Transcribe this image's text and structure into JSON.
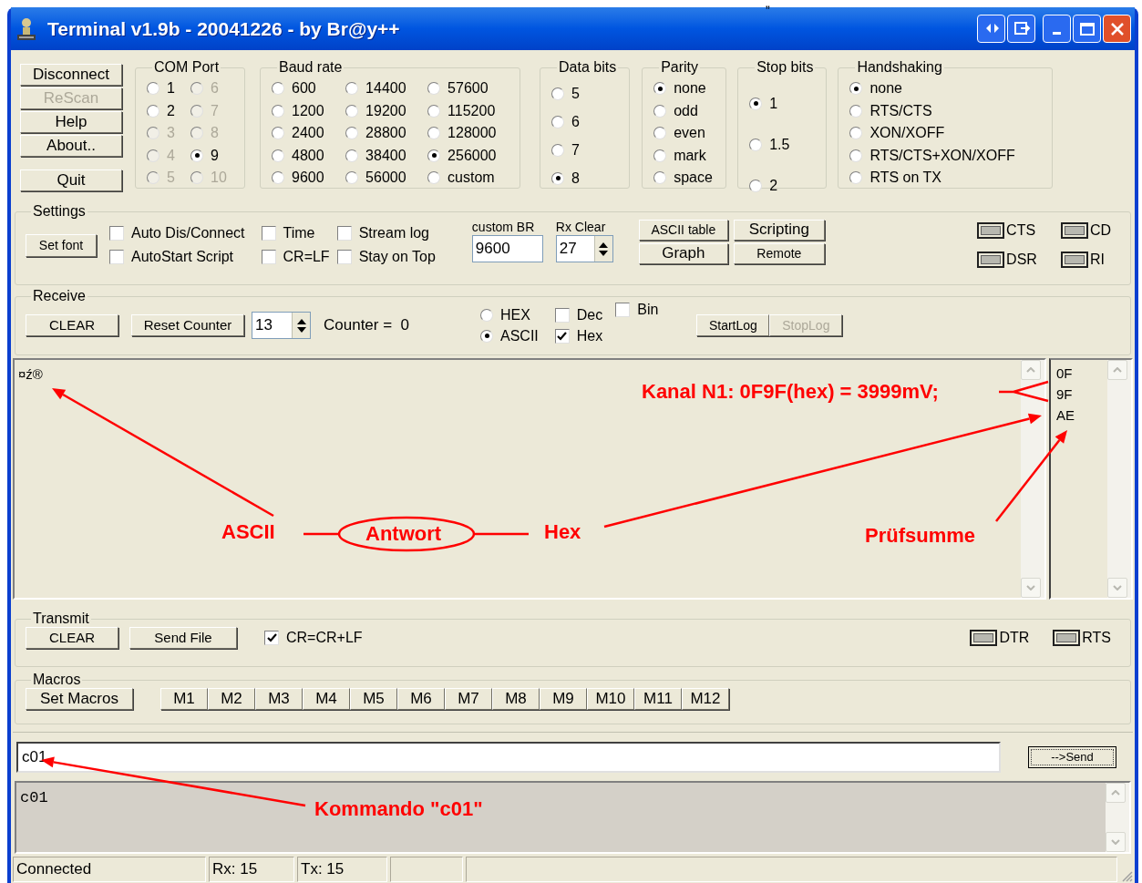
{
  "top_fragment": "„",
  "window": {
    "title": "Terminal v1.9b - 20041226 - by Br@y++"
  },
  "side_buttons": [
    {
      "label": "Disconnect",
      "disabled": false
    },
    {
      "label": "ReScan",
      "disabled": true
    },
    {
      "label": "Help",
      "disabled": false
    },
    {
      "label": "About..",
      "disabled": false
    },
    {
      "label": "Quit",
      "disabled": false
    }
  ],
  "com_port": {
    "title": "COM Port",
    "options": [
      {
        "label": "1",
        "selected": false,
        "disabled": false
      },
      {
        "label": "2",
        "selected": false,
        "disabled": false
      },
      {
        "label": "3",
        "selected": false,
        "disabled": true
      },
      {
        "label": "4",
        "selected": false,
        "disabled": true
      },
      {
        "label": "5",
        "selected": false,
        "disabled": true
      },
      {
        "label": "6",
        "selected": false,
        "disabled": true
      },
      {
        "label": "7",
        "selected": false,
        "disabled": true
      },
      {
        "label": "8",
        "selected": false,
        "disabled": true
      },
      {
        "label": "9",
        "selected": true,
        "disabled": false
      },
      {
        "label": "10",
        "selected": false,
        "disabled": true
      }
    ]
  },
  "baud_rate": {
    "title": "Baud rate",
    "options": [
      {
        "label": "600",
        "selected": false
      },
      {
        "label": "1200",
        "selected": false
      },
      {
        "label": "2400",
        "selected": false
      },
      {
        "label": "4800",
        "selected": false
      },
      {
        "label": "9600",
        "selected": false
      },
      {
        "label": "14400",
        "selected": false
      },
      {
        "label": "19200",
        "selected": false
      },
      {
        "label": "28800",
        "selected": false
      },
      {
        "label": "38400",
        "selected": false
      },
      {
        "label": "56000",
        "selected": false
      },
      {
        "label": "57600",
        "selected": false
      },
      {
        "label": "115200",
        "selected": false
      },
      {
        "label": "128000",
        "selected": false
      },
      {
        "label": "256000",
        "selected": true
      },
      {
        "label": "custom",
        "selected": false
      }
    ]
  },
  "data_bits": {
    "title": "Data bits",
    "options": [
      {
        "label": "5",
        "selected": false
      },
      {
        "label": "6",
        "selected": false
      },
      {
        "label": "7",
        "selected": false
      },
      {
        "label": "8",
        "selected": true
      }
    ]
  },
  "parity": {
    "title": "Parity",
    "options": [
      {
        "label": "none",
        "selected": true
      },
      {
        "label": "odd",
        "selected": false
      },
      {
        "label": "even",
        "selected": false
      },
      {
        "label": "mark",
        "selected": false
      },
      {
        "label": "space",
        "selected": false
      }
    ]
  },
  "stop_bits": {
    "title": "Stop bits",
    "options": [
      {
        "label": "1",
        "selected": true
      },
      {
        "label": "1.5",
        "selected": false
      },
      {
        "label": "2",
        "selected": false
      }
    ]
  },
  "handshaking": {
    "title": "Handshaking",
    "options": [
      {
        "label": "none",
        "selected": true
      },
      {
        "label": "RTS/CTS",
        "selected": false
      },
      {
        "label": "XON/XOFF",
        "selected": false
      },
      {
        "label": "RTS/CTS+XON/XOFF",
        "selected": false
      },
      {
        "label": "RTS on TX",
        "selected": false
      }
    ]
  },
  "settings": {
    "title": "Settings",
    "set_font": "Set font",
    "checkboxes": [
      {
        "label": "Auto Dis/Connect",
        "checked": false
      },
      {
        "label": "AutoStart Script",
        "checked": false
      },
      {
        "label": "Time",
        "checked": false
      },
      {
        "label": "CR=LF",
        "checked": false
      },
      {
        "label": "Stream log",
        "checked": false
      },
      {
        "label": "Stay on Top",
        "checked": false
      }
    ],
    "custom_br": {
      "label": "custom BR",
      "value": "9600"
    },
    "rx_clear": {
      "label": "Rx Clear",
      "value": "27"
    },
    "buttons": [
      "ASCII table",
      "Graph",
      "Scripting",
      "Remote"
    ],
    "leds": [
      {
        "label": "CTS",
        "on": false
      },
      {
        "label": "DSR",
        "on": false
      },
      {
        "label": "CD",
        "on": false
      },
      {
        "label": "RI",
        "on": false
      }
    ]
  },
  "receive": {
    "title": "Receive",
    "clear": "CLEAR",
    "reset_counter": "Reset Counter",
    "counter_value": "13",
    "counter_text": "Counter =  0",
    "modes": [
      {
        "label": "HEX",
        "selected": false
      },
      {
        "label": "ASCII",
        "selected": true
      }
    ],
    "checkboxes": [
      {
        "label": "Dec",
        "checked": false
      },
      {
        "label": "Hex",
        "checked": true
      },
      {
        "label": "Bin",
        "checked": false
      }
    ],
    "log_buttons": [
      {
        "label": "StartLog",
        "disabled": false
      },
      {
        "label": "StopLog",
        "disabled": true
      }
    ]
  },
  "receive_text": "¤ź®",
  "hex_lines": [
    "0F",
    "9F",
    "AE"
  ],
  "annotations": {
    "kanal": "Kanal N1: 0F9F(hex) = 3999mV;",
    "ascii": "ASCII",
    "antwort": "Antwort",
    "hex": "Hex",
    "pruefsumme": "Prüfsumme",
    "kommando": "Kommando \"c01\""
  },
  "transmit": {
    "title": "Transmit",
    "clear": "CLEAR",
    "send_file": "Send File",
    "checkbox": {
      "label": "CR=CR+LF",
      "checked": true
    },
    "leds": [
      {
        "label": "DTR",
        "on": false
      },
      {
        "label": "RTS",
        "on": false
      }
    ]
  },
  "macros": {
    "title": "Macros",
    "set_macros": "Set Macros",
    "buttons": [
      "M1",
      "M2",
      "M3",
      "M4",
      "M5",
      "M6",
      "M7",
      "M8",
      "M9",
      "M10",
      "M11",
      "M12"
    ]
  },
  "input": {
    "value": "c01"
  },
  "send_button": "-->Send",
  "history": "c01",
  "status_bar": [
    "Connected",
    "Rx: 15",
    "Tx: 15"
  ]
}
